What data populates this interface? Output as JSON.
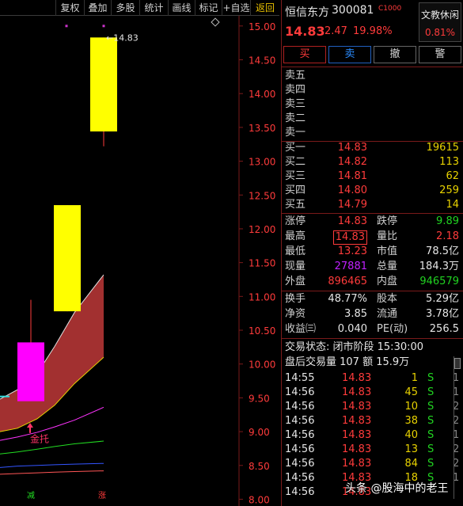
{
  "toolbar": {
    "buttons": [
      "复权",
      "叠加",
      "多股",
      "统计",
      "画线",
      "标记",
      "+自选",
      "返回"
    ]
  },
  "chart": {
    "high_label": "14.83",
    "marker_label": "金托",
    "bottom_marks": [
      "减",
      "涨"
    ],
    "price_axis": [
      "15.00",
      "14.50",
      "14.00",
      "13.50",
      "13.00",
      "12.50",
      "12.00",
      "11.50",
      "11.00",
      "10.50",
      "10.00",
      "9.50",
      "9.00",
      "8.50",
      "8.00"
    ]
  },
  "chart_data": {
    "type": "candlestick",
    "ylim": [
      7.9,
      15.15
    ],
    "candles": [
      {
        "open": 9.45,
        "close": 10.32,
        "high": 10.95,
        "low": 9.45,
        "color": "#ff00ff"
      },
      {
        "open": 10.78,
        "close": 12.35,
        "high": 12.35,
        "low": 10.78,
        "color": "#ffff00"
      },
      {
        "open": 13.44,
        "close": 14.83,
        "high": 14.83,
        "low": 13.22,
        "color": "#ffff00"
      }
    ],
    "band_upper": [
      9.48,
      9.62,
      9.86,
      10.26,
      10.76,
      11.32
    ],
    "band_lower": [
      9.0,
      9.05,
      9.19,
      9.39,
      9.71,
      10.1
    ],
    "line_magenta": [
      8.87,
      8.92,
      8.99,
      9.07,
      9.17,
      9.36
    ],
    "line_green": [
      8.67,
      8.7,
      8.74,
      8.78,
      8.82,
      8.86
    ],
    "line_blue": [
      8.47,
      8.49,
      8.5,
      8.51,
      8.52,
      8.53
    ],
    "line_red": [
      8.37,
      8.38,
      8.39,
      8.4,
      8.41,
      8.42
    ],
    "top_dots": [
      15.0,
      15.0
    ]
  },
  "quote": {
    "name": "恒信东方",
    "code": "300081",
    "badge": "C1000",
    "status_title": "文教休闲",
    "status_pct": "0.81%",
    "price": "14.83",
    "change": "2.47",
    "change_pct": "19.98%"
  },
  "actions": [
    "买",
    "卖",
    "撤",
    "警"
  ],
  "asks": [
    {
      "label": "卖五",
      "price": "",
      "vol": ""
    },
    {
      "label": "卖四",
      "price": "",
      "vol": ""
    },
    {
      "label": "卖三",
      "price": "",
      "vol": ""
    },
    {
      "label": "卖二",
      "price": "",
      "vol": ""
    },
    {
      "label": "卖一",
      "price": "",
      "vol": ""
    }
  ],
  "bids": [
    {
      "label": "买一",
      "price": "14.83",
      "vol": "19615"
    },
    {
      "label": "买二",
      "price": "14.82",
      "vol": "113"
    },
    {
      "label": "买三",
      "price": "14.81",
      "vol": "62"
    },
    {
      "label": "买四",
      "price": "14.80",
      "vol": "259"
    },
    {
      "label": "买五",
      "price": "14.79",
      "vol": "14"
    }
  ],
  "stats1": {
    "limit_up_label": "涨停",
    "limit_up": "14.83",
    "limit_down_label": "跌停",
    "limit_down": "9.89",
    "high_label": "最高",
    "high": "14.83",
    "vol_ratio_label": "量比",
    "vol_ratio": "2.18",
    "low_label": "最低",
    "low": "13.23",
    "mkt_cap_label": "市值",
    "mkt_cap": "78.5亿",
    "cur_vol_label": "现量",
    "cur_vol": "27881",
    "total_vol_label": "总量",
    "total_vol": "184.3万",
    "outer_label": "外盘",
    "outer": "896465",
    "inner_label": "内盘",
    "inner": "946579"
  },
  "stats2": {
    "turnover_label": "换手",
    "turnover": "48.77%",
    "shares_label": "股本",
    "shares": "5.29亿",
    "nav_label": "净资",
    "nav": "3.85",
    "float_label": "流通",
    "float": "3.78亿",
    "eps_label": "收益㈢",
    "eps": "0.040",
    "pe_label": "PE(动)",
    "pe": "256.5"
  },
  "trade_status": "交易状态: 闭市阶段 15:30:00",
  "after_hours": "盘后交易量 107 额 15.9万",
  "ticks": [
    {
      "time": "14:55",
      "price": "14.83",
      "qty": "1",
      "side": "S",
      "n": "1"
    },
    {
      "time": "14:56",
      "price": "14.83",
      "qty": "45",
      "side": "S",
      "n": "1"
    },
    {
      "time": "14:56",
      "price": "14.83",
      "qty": "10",
      "side": "S",
      "n": "2"
    },
    {
      "time": "14:56",
      "price": "14.83",
      "qty": "38",
      "side": "S",
      "n": "2"
    },
    {
      "time": "14:56",
      "price": "14.83",
      "qty": "40",
      "side": "S",
      "n": "1"
    },
    {
      "time": "14:56",
      "price": "14.83",
      "qty": "13",
      "side": "S",
      "n": "2"
    },
    {
      "time": "14:56",
      "price": "14.83",
      "qty": "84",
      "side": "S",
      "n": "2"
    },
    {
      "time": "14:56",
      "price": "14.83",
      "qty": "18",
      "side": "S",
      "n": "1"
    },
    {
      "time": "14:56",
      "price": "14.83",
      "qty": "",
      "side": "",
      "n": ""
    }
  ],
  "watermark": "头条 @股海中的老王"
}
